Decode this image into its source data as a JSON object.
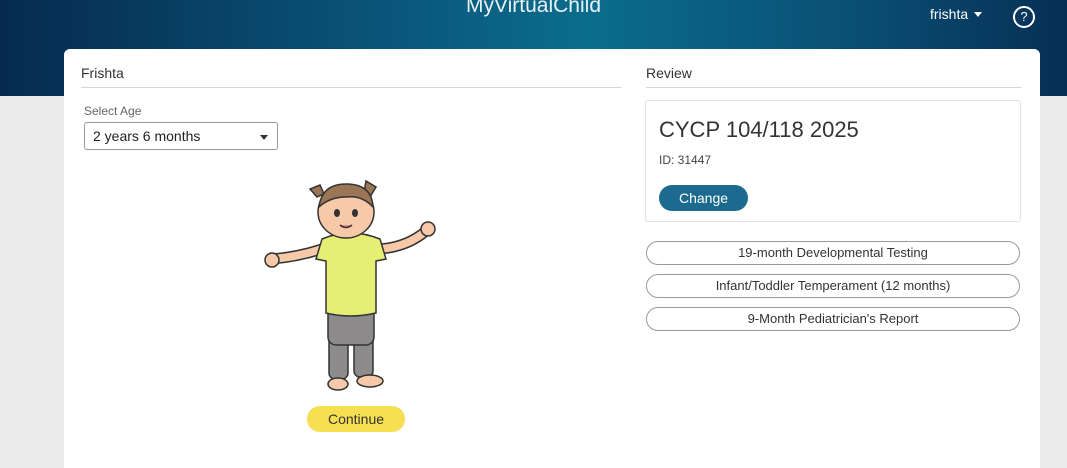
{
  "header": {
    "app_title": "MyVirtualChild",
    "username": "frishta",
    "help_glyph": "?"
  },
  "child": {
    "name": "Frishta",
    "select_age_label": "Select Age",
    "selected_age": "2 years 6 months",
    "continue_label": "Continue"
  },
  "review": {
    "title": "Review",
    "course_name": "CYCP 104/118 2025",
    "course_id": "ID: 31447",
    "change_label": "Change",
    "reports": [
      "19-month Developmental Testing",
      "Infant/Toddler Temperament (12 months)",
      "9-Month Pediatrician's Report"
    ]
  },
  "colors": {
    "header_dark": "#062a4f",
    "header_teal": "#0b6d8c",
    "continue_yellow": "#f7df52",
    "change_blue": "#1c6a8f"
  }
}
